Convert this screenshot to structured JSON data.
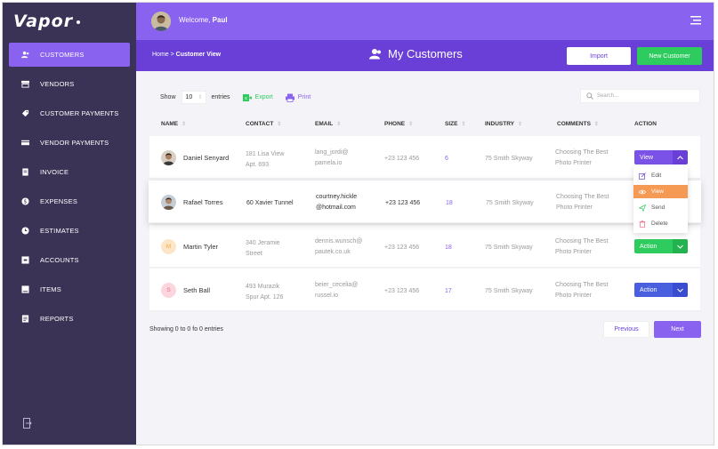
{
  "app": {
    "logo": "Vapor"
  },
  "colors": {
    "sidebar": "#3a3356",
    "accent": "#8a62f0",
    "accent_dark": "#6a3fd8",
    "green": "#2ecc5e",
    "blue": "#4a5fe0",
    "orange": "#f59a55"
  },
  "sidebar": {
    "items": [
      {
        "label": "CUSTOMERS",
        "icon": "users-icon"
      },
      {
        "label": "VENDORS",
        "icon": "store-icon"
      },
      {
        "label": "CUSTOMER PAYMENTS",
        "icon": "tag-icon"
      },
      {
        "label": "VENDOR PAYMENTS",
        "icon": "card-icon"
      },
      {
        "label": "INVOICE",
        "icon": "document-icon"
      },
      {
        "label": "EXPENSES",
        "icon": "dollar-icon"
      },
      {
        "label": "ESTIMATES",
        "icon": "clock-icon"
      },
      {
        "label": "ACCOUNTS",
        "icon": "box-icon"
      },
      {
        "label": "ITEMS",
        "icon": "list-icon"
      },
      {
        "label": "REPORTS",
        "icon": "report-icon"
      }
    ],
    "active_index": 0
  },
  "topbar": {
    "welcome": "Welcome,",
    "user": "Paul"
  },
  "subheader": {
    "breadcrumb_home": "Home >",
    "breadcrumb_current": "Customer View",
    "title": "My Customers",
    "import_label": "Import",
    "new_label": "New Customer"
  },
  "toolbar": {
    "show_label": "Show",
    "entries_value": "10",
    "entries_label": "entries",
    "export_label": "Export",
    "print_label": "Print",
    "search_placeholder": "Search..."
  },
  "table": {
    "headers": {
      "name": "NAME",
      "contact": "CONTACT",
      "email": "EMAIL",
      "phone": "PHONE",
      "size": "SIZE",
      "industry": "INDUSTRY",
      "comments": "COMMENTS",
      "action": "ACTION"
    },
    "rows": [
      {
        "name": "Daniel Senyard",
        "avatar": "photo",
        "initial": "",
        "contact1": "181 Lisa View",
        "contact2": "Apt. 693",
        "email1": "lang_jordi@",
        "email2": "pamela.io",
        "phone": "+23 123 456",
        "size": "6",
        "industry": "75 Smith Skyway",
        "comment1": "Choosing The Best",
        "comment2": "Photo Printer",
        "action": "View",
        "action_color": "purple"
      },
      {
        "name": "Rafael Torres",
        "avatar": "photo",
        "initial": "",
        "contact1": "60 Xavier Tunnel",
        "contact2": "",
        "email1": "courtney.hickle",
        "email2": "@hotmail.com",
        "phone": "+23 123 456",
        "size": "18",
        "industry": "75 Smith Skyway",
        "comment1": "Choosing The Best",
        "comment2": "Photo Printer",
        "action": "",
        "action_color": ""
      },
      {
        "name": "Martin Tyler",
        "avatar": "initial",
        "initial": "M",
        "contact1": "340 Jeramie",
        "contact2": "Street",
        "email1": "dennis.wunsch@",
        "email2": "pautek.co.uk",
        "phone": "+23 123 456",
        "size": "18",
        "industry": "75 Smith Skyway",
        "comment1": "Choosing The Best",
        "comment2": "Photo Printer",
        "action": "Action",
        "action_color": "green"
      },
      {
        "name": "Seth Ball",
        "avatar": "initial",
        "initial": "S",
        "contact1": "493 Murazik",
        "contact2": "Spur Apt. 126",
        "email1": "beier_cecelia@",
        "email2": "russel.io",
        "phone": "+23 123 456",
        "size": "17",
        "industry": "75 Smith Skyway",
        "comment1": "Choosing The Best",
        "comment2": "Photo Printer",
        "action": "Action",
        "action_color": "blue"
      }
    ]
  },
  "dropdown": {
    "items": [
      {
        "label": "Edit",
        "icon": "edit-icon"
      },
      {
        "label": "View",
        "icon": "eye-icon",
        "active": true
      },
      {
        "label": "Send",
        "icon": "send-icon"
      },
      {
        "label": "Delete",
        "icon": "trash-icon"
      }
    ]
  },
  "footer": {
    "showing": "Showing 0 to 0 fo 0 entries",
    "previous": "Previous",
    "next": "Next"
  }
}
